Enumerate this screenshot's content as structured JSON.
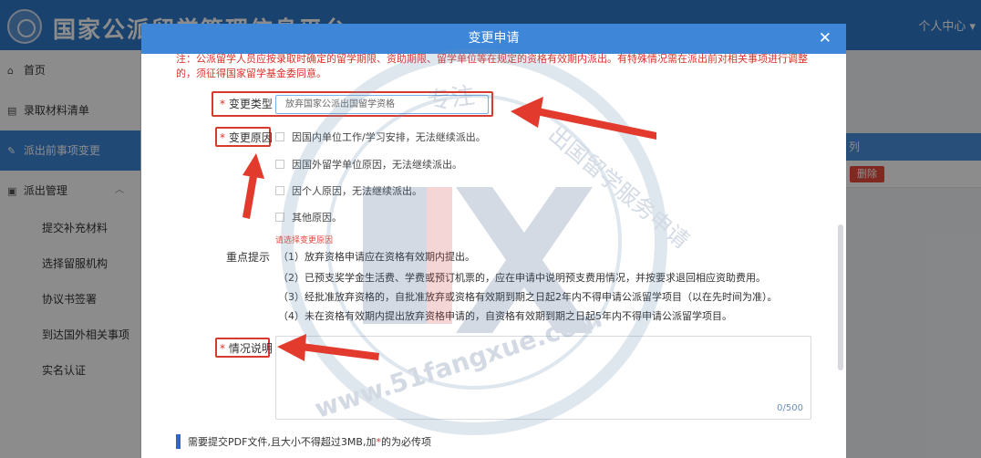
{
  "app": {
    "title": "国家公派留学管理信息平台",
    "user_menu": "个人中心 ▾"
  },
  "sidebar": {
    "items": [
      {
        "icon": "home-icon",
        "glyph": "⌂",
        "label": "首页"
      },
      {
        "icon": "list-icon",
        "glyph": "▤",
        "label": "录取材料清单"
      },
      {
        "icon": "pencil-icon",
        "glyph": "✎",
        "label": "派出前事项变更"
      },
      {
        "icon": "folder-icon",
        "glyph": "▣",
        "label": "派出管理"
      }
    ],
    "sub_items": [
      "提交补充材料",
      "选择留服机构",
      "协议书签署",
      "到达国外相关事项",
      "实名认证"
    ]
  },
  "background_table": {
    "header_text": "列",
    "delete_label": "删除"
  },
  "modal": {
    "title": "变更申请",
    "close": "✕",
    "notice": "注：公派留学人员应按录取时确定的留学期限、资助期限、留学单位等在规定的资格有效期内派出。有特殊情况需在派出前对相关事项进行调整的，须征得国家留学基金委同意。",
    "required_mark": "*",
    "change_type": {
      "label": "变更类型",
      "value": "放弃国家公派出国留学资格"
    },
    "change_reason": {
      "label": "变更原因",
      "options": [
        "因国内单位工作/学习安排，无法继续派出。",
        "因国外留学单位原因，无法继续派出。",
        "因个人原因，无法继续派出。",
        "其他原因。"
      ],
      "error": "请选择变更原因"
    },
    "tips": {
      "label": "重点提示",
      "lines": [
        "（1）放弃资格申请应在资格有效期内提出。",
        "（2）已预支奖学金生活费、学费或预订机票的，应在申请中说明预支费用情况，并按要求退回相应资助费用。",
        "（3）经批准放弃资格的，自批准放弃或资格有效期到期之日起2年内不得申请公派留学项目（以在先时间为准）。",
        "（4）未在资格有效期内提出放弃资格申请的，自资格有效期到期之日起5年内不得申请公派留学项目。"
      ]
    },
    "description": {
      "label": "情况说明",
      "counter": "0/500"
    },
    "file_note": {
      "text_before": "需要提交PDF文件,且大小不得超过3MB,加",
      "star": "*",
      "text_after": "的为必传项"
    }
  },
  "watermark": {
    "left_text": "专注",
    "right_text": "出国留学服务申请",
    "bottom_text": "www.51fangxue.com",
    "logo_text": "FX"
  },
  "colors": {
    "primary": "#3d86d8",
    "danger": "#d93a2e",
    "annotation_red": "#e23b2e"
  }
}
